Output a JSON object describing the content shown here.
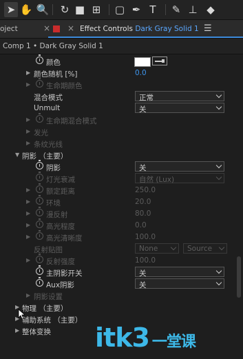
{
  "toolbar": {
    "tools": [
      {
        "icon": "selection-arrow-icon",
        "glyph": "➤"
      },
      {
        "icon": "hand-icon",
        "glyph": "✋"
      },
      {
        "icon": "zoom-icon",
        "glyph": "🔍"
      },
      {
        "icon": "rotate-icon",
        "glyph": "↻"
      },
      {
        "icon": "camera-icon",
        "glyph": "■"
      },
      {
        "icon": "pan-behind-icon",
        "glyph": "⊞"
      },
      {
        "icon": "rectangle-icon",
        "glyph": "▢"
      },
      {
        "icon": "pen-icon",
        "glyph": "✒"
      },
      {
        "icon": "type-icon",
        "glyph": "T"
      },
      {
        "icon": "brush-icon",
        "glyph": "✎"
      },
      {
        "icon": "stamp-icon",
        "glyph": "⊥"
      },
      {
        "icon": "eraser-icon",
        "glyph": "◆"
      }
    ]
  },
  "tabs": {
    "project_label": "oject",
    "close_glyph": "×",
    "effect_controls_label": "Effect Controls",
    "layer_name": "Dark Gray Solid 1",
    "menu_glyph": "☰"
  },
  "comp_path": "Comp 1 • Dark Gray Solid 1",
  "rows": [
    {
      "label": "颜色",
      "stopwatch": true,
      "type": "color"
    },
    {
      "label": "颜色随机 [%]",
      "twirl": true,
      "value": "0.0",
      "value_color": "blue"
    },
    {
      "label": "生命期颜色",
      "twirl": true,
      "stopwatch": true,
      "dim": true
    },
    {
      "label": "混合模式",
      "dropdown": "正常"
    },
    {
      "label": "Unmult",
      "dropdown": "关"
    },
    {
      "label": "生命期混合模式",
      "twirl": true,
      "stopwatch": true,
      "dim": true
    },
    {
      "label": "发光",
      "twirl": true,
      "dim": true
    },
    {
      "label": "条纹光线",
      "twirl": true,
      "dim": true
    },
    {
      "label": "阴影  （主要）",
      "twirl": "open",
      "level": 0
    },
    {
      "label": "阴影",
      "stopwatch": true,
      "dropdown": "关"
    },
    {
      "label": "灯光衰减",
      "stopwatch": true,
      "dim": true,
      "dropdown": "自然 (Lux)"
    },
    {
      "label": "额定距离",
      "twirl": true,
      "stopwatch": true,
      "dim": true,
      "value": "250.0"
    },
    {
      "label": "环境",
      "twirl": true,
      "stopwatch": true,
      "dim": true,
      "value": "20.0"
    },
    {
      "label": "漫反射",
      "twirl": true,
      "stopwatch": true,
      "dim": true,
      "value": "80.0"
    },
    {
      "label": "高光程度",
      "twirl": true,
      "stopwatch": true,
      "dim": true,
      "value": "0.0"
    },
    {
      "label": "高光清晰度",
      "twirl": true,
      "stopwatch": true,
      "dim": true,
      "value": "100.0"
    },
    {
      "label": "反射贴图",
      "dim": true,
      "dropdown2": [
        "None",
        "Source"
      ]
    },
    {
      "label": "反射强度",
      "twirl": true,
      "stopwatch": true,
      "dim": true,
      "value": "100.0"
    },
    {
      "label": "主阴影开关",
      "stopwatch": true,
      "dropdown": "关"
    },
    {
      "label": "Aux阴影",
      "stopwatch": true,
      "dropdown": "关"
    },
    {
      "label": "阴影设置",
      "twirl": true,
      "dim": true
    },
    {
      "label": "物理  （主要）",
      "twirl": true,
      "level": 0
    },
    {
      "label": "辅助系统  （主要）",
      "twirl": true,
      "level": 0
    },
    {
      "label": "整体变换",
      "twirl": true,
      "level": 0
    }
  ],
  "watermark": {
    "text": "itk3",
    "sub": "一堂课"
  },
  "colors": {
    "accent": "#3d8bdc",
    "value_blue": "#3e95ec",
    "watermark": "#3db8e8"
  }
}
